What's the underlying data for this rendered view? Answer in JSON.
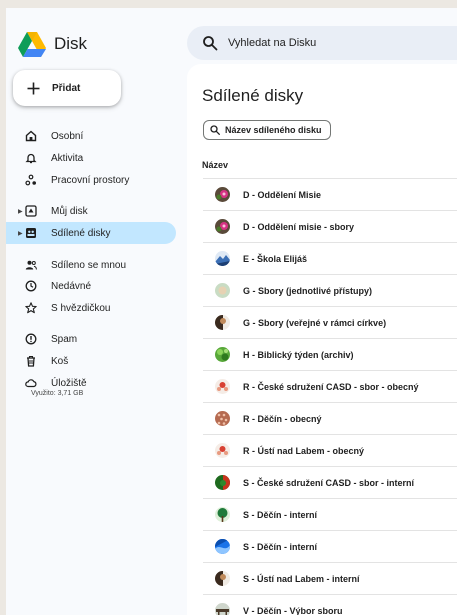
{
  "app": {
    "name": "Disk"
  },
  "search": {
    "placeholder": "Vyhledat na Disku"
  },
  "new_button": {
    "label": "Přidat"
  },
  "nav": {
    "items": [
      {
        "label": "Osobní",
        "icon": "home-icon"
      },
      {
        "label": "Aktivita",
        "icon": "bell-icon"
      },
      {
        "label": "Pracovní prostory",
        "icon": "workspaces-icon"
      },
      {
        "label": "Můj disk",
        "icon": "my-drive-icon"
      },
      {
        "label": "Sdílené disky",
        "icon": "shared-drives-icon",
        "active": true
      },
      {
        "label": "Sdíleno se mnou",
        "icon": "people-icon"
      },
      {
        "label": "Nedávné",
        "icon": "clock-icon"
      },
      {
        "label": "S hvězdičkou",
        "icon": "star-icon"
      },
      {
        "label": "Spam",
        "icon": "spam-icon"
      },
      {
        "label": "Koš",
        "icon": "trash-icon"
      },
      {
        "label": "Úložiště",
        "icon": "cloud-icon"
      }
    ],
    "storage_used": "Využito: 3,71 GB"
  },
  "main": {
    "title": "Sdílené disky",
    "filter_chip": "Název sdíleného disku",
    "column_header": "Název",
    "rows": [
      {
        "name": "D - Oddělení Misie",
        "avatar": "pink-flower"
      },
      {
        "name": "D - Oddělení misie - sbory",
        "avatar": "pink-flower"
      },
      {
        "name": "E - Škola Elijáš",
        "avatar": "mountain"
      },
      {
        "name": "G - Sbory (jednotlivé přístupy)",
        "avatar": "pale-green"
      },
      {
        "name": "G - Sbory (veřejné v rámci církve)",
        "avatar": "brown-figure"
      },
      {
        "name": "H - Biblický týden (archiv)",
        "avatar": "green-leaves"
      },
      {
        "name": "R - České sdružení CASD - sbor - obecný",
        "avatar": "red-flower"
      },
      {
        "name": "R - Děčín - obecný",
        "avatar": "dotted-red"
      },
      {
        "name": "R - Ústí nad Labem - obecný",
        "avatar": "red-flower"
      },
      {
        "name": "S - České sdružení CASD - sbor - interní",
        "avatar": "green-red"
      },
      {
        "name": "S - Děčín - interní",
        "avatar": "green-tree"
      },
      {
        "name": "S - Děčín - interní",
        "avatar": "blue-wave"
      },
      {
        "name": "S - Ústí nad Labem - interní",
        "avatar": "brown-figure"
      },
      {
        "name": "V - Děčín - Výbor sboru",
        "avatar": "desk"
      }
    ]
  },
  "colors": {
    "active_nav": "#c2e7ff",
    "search_bg": "#e9eef6",
    "app_bg": "#f8fafd"
  }
}
